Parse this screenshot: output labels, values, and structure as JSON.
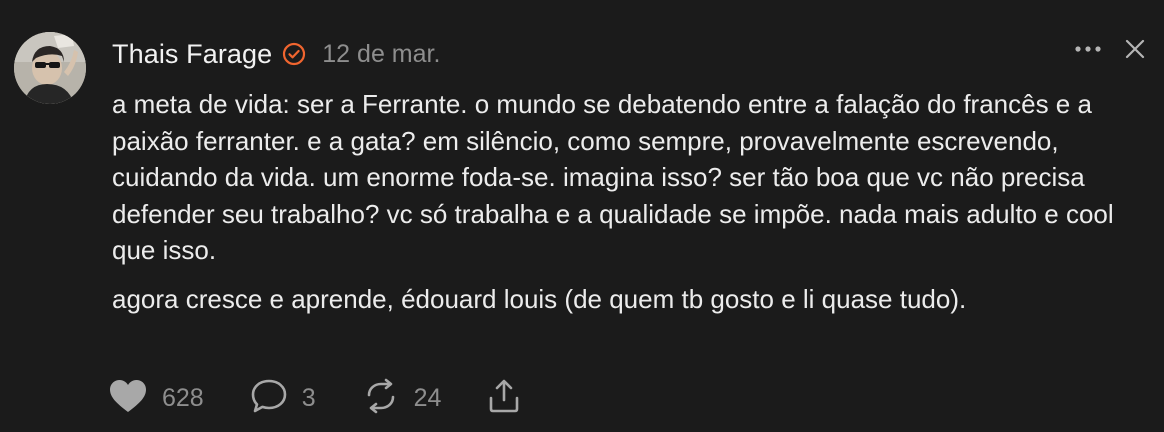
{
  "post": {
    "author": "Thais Farage",
    "date": "12 de mar.",
    "paragraphs": [
      "a meta de vida: ser a Ferrante. o mundo se debatendo entre a falação do francês e a paixão ferranter. e a gata? em silêncio, como sempre, provavelmente escrevendo, cuidando da vida. um enorme foda-se. imagina isso? ser tão boa que vc não precisa defender seu trabalho? vc só trabalha e a qualidade se impõe. nada mais adulto e cool que isso.",
      "agora cresce e aprende, édouard louis (de quem tb gosto e li quase tudo)."
    ],
    "verified_icon": "verified-badge-icon",
    "verified_color": "#f0652f"
  },
  "stats": {
    "likes": "628",
    "replies": "3",
    "reposts": "24"
  },
  "colors": {
    "background": "#1b1b1b",
    "text": "#ececec",
    "muted": "#8e8e8e"
  }
}
